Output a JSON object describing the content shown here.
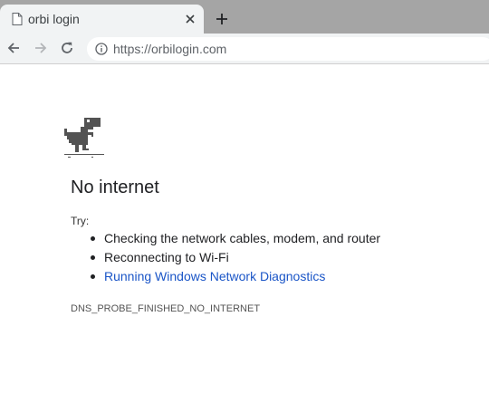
{
  "browser": {
    "tab": {
      "title": "orbi login",
      "icon": "page-icon"
    },
    "close_icon": "close-icon",
    "new_tab_icon": "plus-icon",
    "nav": {
      "back_icon": "arrow-left-icon",
      "forward_icon": "arrow-right-icon",
      "reload_icon": "reload-icon"
    },
    "address_bar": {
      "url": "https://orbilogin.com",
      "info_icon": "info-icon"
    }
  },
  "page": {
    "illustration": "dinosaur-icon",
    "heading": "No internet",
    "try_label": "Try:",
    "suggestions": [
      {
        "text": "Checking the network cables, modem, and router",
        "is_link": false
      },
      {
        "text": "Reconnecting to Wi-Fi",
        "is_link": false
      },
      {
        "text": "Running Windows Network Diagnostics",
        "is_link": true
      }
    ],
    "error_code": "DNS_PROBE_FINISHED_NO_INTERNET"
  },
  "colors": {
    "tabstrip": "#a5a5a5",
    "toolbar": "#f1f3f4",
    "link": "#1a55c7",
    "text": "#202124"
  }
}
